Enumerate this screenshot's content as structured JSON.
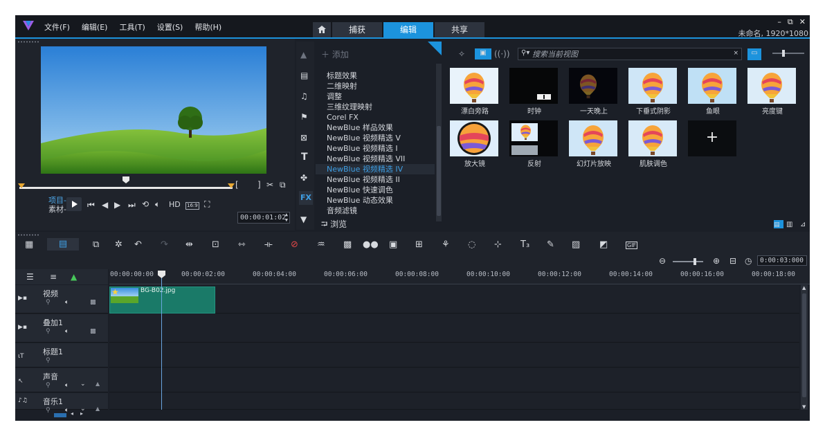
{
  "menu": [
    "文件(F)",
    "编辑(E)",
    "工具(T)",
    "设置(S)",
    "帮助(H)"
  ],
  "tabs": {
    "capture": "捕获",
    "edit": "编辑",
    "share": "共享"
  },
  "window": {
    "minimize": "–",
    "restore": "⧉",
    "close": "✕"
  },
  "project_info": "未命名, 1920*1080",
  "preview": {
    "mode_project": "项目-",
    "mode_clip": "素材-",
    "hd": "HD",
    "aspect": "16:9",
    "timecode": "00:00:01:02"
  },
  "library": {
    "add_label": "添加",
    "categories": [
      "标题效果",
      "二维映射",
      "调整",
      "三维纹理映射",
      "Corel FX",
      "NewBlue 样品效果",
      "NewBlue 视频精选 V",
      "NewBlue 视频精选 I",
      "NewBlue 视频精选 VII",
      "NewBlue 视频精选 IV",
      "NewBlue 视频精选 II",
      "NewBlue 快速调色",
      "NewBlue 动态效果",
      "音频滤镜"
    ],
    "selected_index": 9,
    "browse_label": "浏览",
    "search_placeholder": "搜索当前视图",
    "side_fx": "FX"
  },
  "effects": [
    {
      "label": "漂白旁路"
    },
    {
      "label": "时钟"
    },
    {
      "label": "一天晚上"
    },
    {
      "label": "下垂式阴影"
    },
    {
      "label": "鱼眼"
    },
    {
      "label": "亮度键"
    },
    {
      "label": "放大镜"
    },
    {
      "label": "反射"
    },
    {
      "label": "幻灯片放映"
    },
    {
      "label": "肌肤调色"
    }
  ],
  "add_tile": "+",
  "timeline": {
    "zoom_timecode": "0:00:03:000",
    "ruler": [
      "00:00:00:00",
      "00:00:02:00",
      "00:00:04:00",
      "00:00:06:00",
      "00:00:08:00",
      "00:00:10:00",
      "00:00:12:00",
      "00:00:14:00",
      "00:00:16:00",
      "00:00:18:00"
    ],
    "tracks": [
      "视频",
      "叠加1",
      "标题1",
      "声音",
      "音乐1"
    ],
    "clip_name": "BG-B02.jpg"
  },
  "colors": {
    "accent": "#1c93dd",
    "bg": "#1b1f27",
    "clip": "#1a7a68",
    "trim": "#e7a732"
  }
}
